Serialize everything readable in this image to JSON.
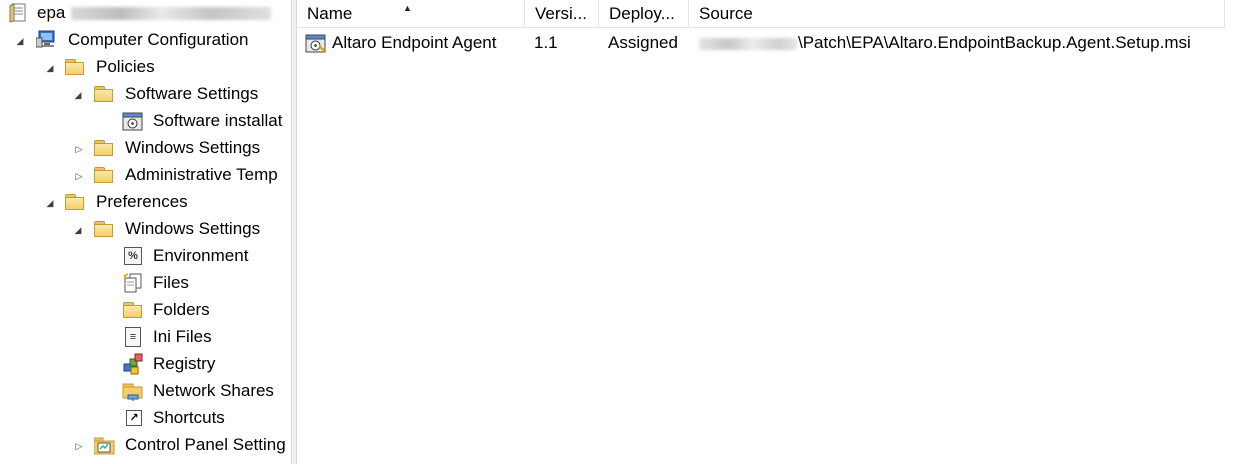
{
  "tree": {
    "root_label": "epa",
    "nodes": [
      {
        "label": "Computer Configuration",
        "icon": "computer-config-icon",
        "expander": "collapse"
      },
      {
        "label": "Policies",
        "icon": "folder-icon",
        "expander": "collapse"
      },
      {
        "label": "Software Settings",
        "icon": "folder-icon",
        "expander": "collapse"
      },
      {
        "label": "Software installat",
        "icon": "software-installation-icon",
        "expander": ""
      },
      {
        "label": "Windows Settings",
        "icon": "folder-icon",
        "expander": "expand"
      },
      {
        "label": "Administrative Temp",
        "icon": "folder-icon",
        "expander": "expand"
      },
      {
        "label": "Preferences",
        "icon": "folder-icon",
        "expander": "collapse"
      },
      {
        "label": "Windows Settings",
        "icon": "folder-icon",
        "expander": "collapse"
      },
      {
        "label": "Environment",
        "icon": "environment-icon",
        "expander": ""
      },
      {
        "label": "Files",
        "icon": "files-icon",
        "expander": ""
      },
      {
        "label": "Folders",
        "icon": "folders-icon",
        "expander": ""
      },
      {
        "label": "Ini Files",
        "icon": "ini-files-icon",
        "expander": ""
      },
      {
        "label": "Registry",
        "icon": "registry-icon",
        "expander": ""
      },
      {
        "label": "Network Shares",
        "icon": "network-shares-icon",
        "expander": ""
      },
      {
        "label": "Shortcuts",
        "icon": "shortcuts-icon",
        "expander": ""
      },
      {
        "label": "Control Panel Setting",
        "icon": "control-panel-icon",
        "expander": "expand"
      }
    ],
    "glyphs": {
      "collapse": "◢",
      "expand": "▷",
      "env_box": "%",
      "shortcut_box": "↗",
      "ini_box": "≡"
    }
  },
  "list": {
    "columns": [
      "Name",
      "Versi...",
      "Deploy...",
      "Source"
    ],
    "sort_glyph": "▲",
    "rows": [
      {
        "name": "Altaro Endpoint Agent",
        "version": "1.1",
        "deployment": "Assigned",
        "source": "\\Patch\\EPA\\Altaro.EndpointBackup.Agent.Setup.msi"
      }
    ]
  },
  "colors": {
    "folder": "#f3cf68",
    "border": "#e4e4e4"
  }
}
